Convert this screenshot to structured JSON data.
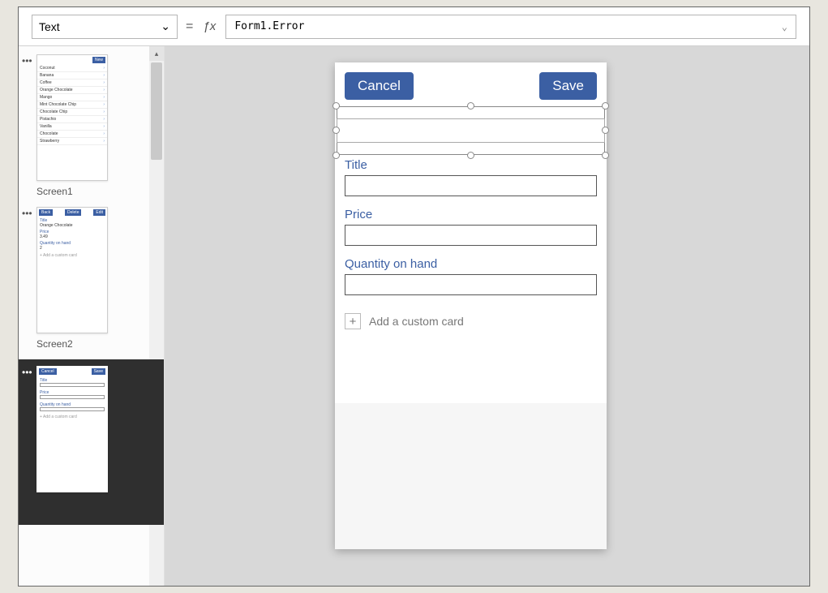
{
  "formula_bar": {
    "property": "Text",
    "expression": "Form1.Error"
  },
  "thumbnails": {
    "screen1": {
      "label": "Screen1",
      "new_button": "New",
      "items": [
        "Coconut",
        "Banana",
        "Coffee",
        "Orange Chocolate",
        "Mango",
        "Mint Chocolate Chip",
        "Chocolate Chip",
        "Pistachio",
        "Vanilla",
        "Chocolate",
        "Strawberry"
      ]
    },
    "screen2": {
      "label": "Screen2",
      "back_button": "Back",
      "delete_button": "Delete",
      "edit_button": "Edit",
      "title_label": "Title",
      "title_value": "Orange Chocolate",
      "price_label": "Price",
      "price_value": "3.49",
      "qty_label": "Quantity on hand",
      "qty_value": "2",
      "add_card": "+  Add a custom card"
    },
    "screen3": {
      "cancel_button": "Cancel",
      "save_button": "Save",
      "title_label": "Title",
      "price_label": "Price",
      "qty_label": "Quantity on hand",
      "add_card": "+  Add a custom card"
    }
  },
  "preview": {
    "cancel": "Cancel",
    "save": "Save",
    "fields": {
      "title_label": "Title",
      "price_label": "Price",
      "qty_label": "Quantity on hand"
    },
    "add_card": "Add a custom card"
  }
}
